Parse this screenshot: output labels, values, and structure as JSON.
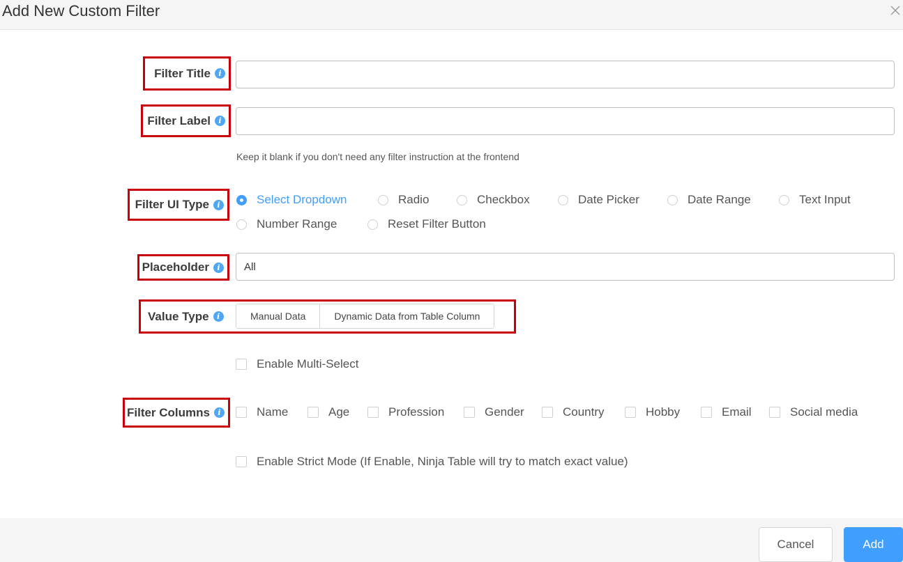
{
  "dialog": {
    "title": "Add New Custom Filter"
  },
  "fields": {
    "filter_title": {
      "label": "Filter Title",
      "value": "",
      "placeholder": ""
    },
    "filter_label": {
      "label": "Filter Label",
      "value": "",
      "placeholder": "",
      "help": "Keep it blank if you don't need any filter instruction at the frontend"
    },
    "filter_ui_type": {
      "label": "Filter UI Type",
      "selected": "Select Dropdown",
      "options": [
        "Select Dropdown",
        "Radio",
        "Checkbox",
        "Date Picker",
        "Date Range",
        "Text Input",
        "Number Range",
        "Reset Filter Button"
      ]
    },
    "placeholder": {
      "label": "Placeholder",
      "value": "All"
    },
    "value_type": {
      "label": "Value Type",
      "options": [
        "Manual Data",
        "Dynamic Data from Table Column"
      ]
    },
    "multi_select": {
      "label": "Enable Multi-Select",
      "checked": false
    },
    "filter_columns": {
      "label": "Filter Columns",
      "options": [
        "Name",
        "Age",
        "Profession",
        "Gender",
        "Country",
        "Hobby",
        "Email",
        "Social media"
      ]
    },
    "strict_mode": {
      "label": "Enable Strict Mode (If Enable, Ninja Table will try to match exact value)",
      "checked": false
    }
  },
  "footer": {
    "cancel_label": "Cancel",
    "add_label": "Add"
  },
  "colors": {
    "accent": "#409eff",
    "highlight_border": "#c9000b",
    "info_icon": "#4fa7f4"
  }
}
